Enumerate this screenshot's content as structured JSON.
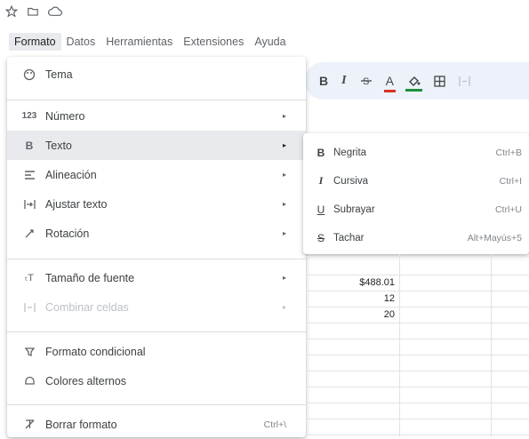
{
  "top_icons": [
    "star-icon",
    "folder-icon",
    "cloud-icon"
  ],
  "menubar": [
    {
      "label": "Formato",
      "active": true
    },
    {
      "label": "Datos",
      "active": false
    },
    {
      "label": "Herramientas",
      "active": false
    },
    {
      "label": "Extensiones",
      "active": false
    },
    {
      "label": "Ayuda",
      "active": false
    }
  ],
  "toolbar": {
    "bold": "B",
    "italic": "I",
    "strike": "S",
    "text_color": "A",
    "fill_color": "A"
  },
  "format_menu": {
    "tema": "Tema",
    "numero": "Número",
    "texto": "Texto",
    "alineacion": "Alineación",
    "ajustar": "Ajustar texto",
    "rotacion": "Rotación",
    "tamano": "Tamaño de fuente",
    "combinar": "Combinar celdas",
    "condicional": "Formato condicional",
    "alternos": "Colores alternos",
    "borrar": "Borrar formato",
    "borrar_shortcut": "Ctrl+\\"
  },
  "text_submenu": {
    "negrita": {
      "label": "Negrita",
      "shortcut": "Ctrl+B"
    },
    "cursiva": {
      "label": "Cursiva",
      "shortcut": "Ctrl+I"
    },
    "subrayar": {
      "label": "Subrayar",
      "shortcut": "Ctrl+U"
    },
    "tachar": {
      "label": "Tachar",
      "shortcut": "Alt+Mayús+5"
    }
  },
  "cells": [
    "$488.01",
    "12",
    "20"
  ],
  "colors": {
    "menu_bg": "#ffffff",
    "selected_row": "#e8eaed",
    "toolbar_bg": "#edf2fa",
    "text_color_bar": "#d93025",
    "fill_color_bar": "#1e8e3e"
  }
}
